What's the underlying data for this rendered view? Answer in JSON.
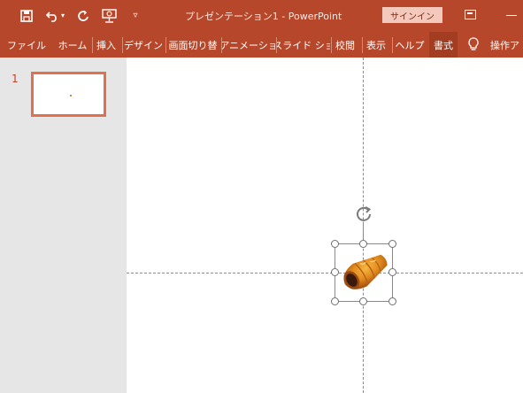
{
  "app": {
    "title": "プレゼンテーション1  -  PowerPoint",
    "signin_label": "サインイン"
  },
  "qat": {
    "save_icon": "save-icon",
    "undo_icon": "undo-icon",
    "redo_icon": "redo-icon",
    "present_icon": "from-beginning-icon",
    "customize_icon": "customize-qat-icon"
  },
  "ribbon": {
    "tabs": [
      {
        "label": "ファイル"
      },
      {
        "label": "ホーム"
      },
      {
        "label": "挿入"
      },
      {
        "label": "デザイン"
      },
      {
        "label": "画面切り替"
      },
      {
        "label": "アニメーショ"
      },
      {
        "label": "スライド ショ"
      },
      {
        "label": "校閲"
      },
      {
        "label": "表示"
      },
      {
        "label": "ヘルプ"
      },
      {
        "label": "書式"
      }
    ],
    "active_tab": "書式",
    "tell_me": "操作ア"
  },
  "slides": [
    {
      "number": "1"
    }
  ],
  "colors": {
    "accent": "#b7472a",
    "active_tab": "#a23d22",
    "thumb_border": "#e07050"
  }
}
